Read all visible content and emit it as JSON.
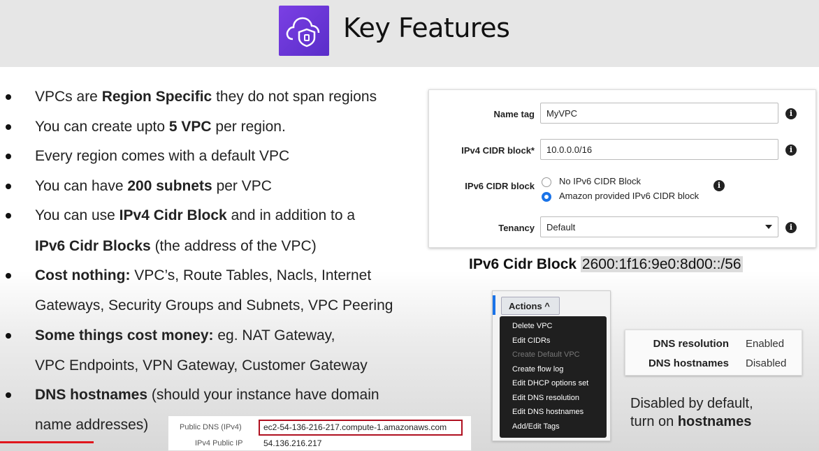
{
  "header": {
    "title": "Key Features"
  },
  "bullets": [
    {
      "lines": [
        [
          {
            "t": "VPCs are ",
            "b": false
          },
          {
            "t": "Region Specific",
            "b": true
          },
          {
            "t": " they do not span regions",
            "b": false
          }
        ]
      ]
    },
    {
      "lines": [
        [
          {
            "t": "You can create upto ",
            "b": false
          },
          {
            "t": "5 VPC",
            "b": true
          },
          {
            "t": " per region.",
            "b": false
          }
        ]
      ]
    },
    {
      "lines": [
        [
          {
            "t": "Every region comes with a default VPC",
            "b": false
          }
        ]
      ]
    },
    {
      "lines": [
        [
          {
            "t": "You can have ",
            "b": false
          },
          {
            "t": "200 subnets",
            "b": true
          },
          {
            "t": " per VPC",
            "b": false
          }
        ]
      ]
    },
    {
      "lines": [
        [
          {
            "t": "You can use ",
            "b": false
          },
          {
            "t": "IPv4 Cidr Block",
            "b": true
          },
          {
            "t": " and in addition to a",
            "b": false
          }
        ],
        [
          {
            "t": "IPv6 Cidr Blocks",
            "b": true
          },
          {
            "t": " (the address of the VPC)",
            "b": false
          }
        ]
      ]
    },
    {
      "lines": [
        [
          {
            "t": "Cost nothing:",
            "b": true
          },
          {
            "t": " VPC’s, Route Tables, Nacls, Internet",
            "b": false
          }
        ],
        [
          {
            "t": "Gateways, Security Groups and Subnets, VPC Peering",
            "b": false
          }
        ]
      ]
    },
    {
      "lines": [
        [
          {
            "t": "Some things cost money:",
            "b": true
          },
          {
            "t": " eg. NAT Gateway,",
            "b": false
          }
        ],
        [
          {
            "t": "VPC Endpoints, VPN Gateway, Customer Gateway",
            "b": false
          }
        ]
      ]
    },
    {
      "lines": [
        [
          {
            "t": "DNS hostnames",
            "b": true
          },
          {
            "t": " (should your instance have domain",
            "b": false
          }
        ],
        [
          {
            "t": "name addresses)",
            "b": false
          }
        ]
      ]
    }
  ],
  "vpc_form": {
    "name_tag_label": "Name tag",
    "name_tag_value": "MyVPC",
    "ipv4_label": "IPv4 CIDR block*",
    "ipv4_value": "10.0.0.0/16",
    "ipv6_label": "IPv6 CIDR block",
    "ipv6_option_none": "No IPv6 CIDR Block",
    "ipv6_option_amazon": "Amazon provided IPv6 CIDR block",
    "ipv6_selected": "Amazon provided IPv6 CIDR block",
    "tenancy_label": "Tenancy",
    "tenancy_value": "Default",
    "info_glyph": "i"
  },
  "cidr_caption": {
    "label": "IPv6 Cidr Block",
    "value": "2600:1f16:9e0:8d00::/56"
  },
  "actions_menu": {
    "button_label": "Actions ^",
    "items": [
      {
        "label": "Delete VPC",
        "enabled": true
      },
      {
        "label": "Edit CIDRs",
        "enabled": true
      },
      {
        "label": "Create Default VPC",
        "enabled": false
      },
      {
        "label": "Create flow log",
        "enabled": true
      },
      {
        "label": "Edit DHCP options set",
        "enabled": true
      },
      {
        "label": "Edit DNS resolution",
        "enabled": true
      },
      {
        "label": "Edit DNS hostnames",
        "enabled": true
      },
      {
        "label": "Add/Edit Tags",
        "enabled": true
      }
    ]
  },
  "dns_settings": {
    "resolution_label": "DNS resolution",
    "resolution_value": "Enabled",
    "hostnames_label": "DNS hostnames",
    "hostnames_value": "Disabled"
  },
  "note": {
    "line1": "Disabled by default,",
    "line2_prefix": "turn on ",
    "line2_bold": "hostnames"
  },
  "public_dns": {
    "dns_label": "Public DNS (IPv4)",
    "dns_value": "ec2-54-136-216-217.compute-1.amazonaws.com",
    "ip_label": "IPv4 Public IP",
    "ip_value": "54.136.216.217"
  },
  "video_progress": 0.114,
  "colors": {
    "logo": "#6b35d9",
    "accent_blue": "#1a73e8",
    "highlight_red": "#b01020",
    "progress_red": "#e0161d"
  },
  "icons": [
    "cloud-shield-icon",
    "info-icon",
    "dropdown-caret-icon"
  ]
}
